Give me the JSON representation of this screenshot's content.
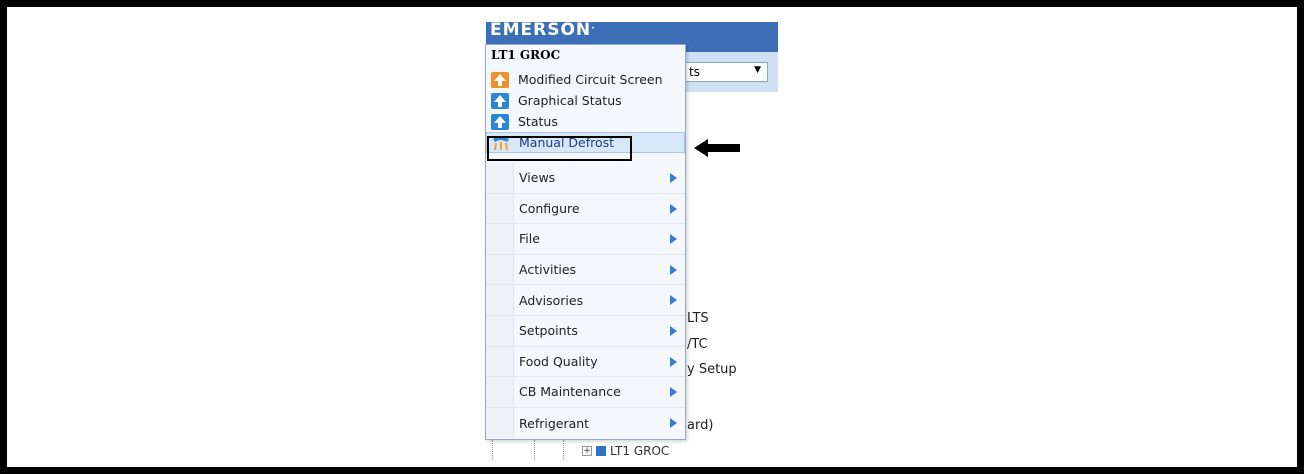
{
  "background": {
    "logo": "EMERSON",
    "select_value": "ts",
    "fragments": [
      "LTS",
      "/TC",
      "y Setup",
      "ard)"
    ],
    "tree_node_label": "LT1 GROC"
  },
  "menu": {
    "title": "LT1 GROC",
    "quick_items": [
      {
        "label": "Modified Circuit Screen",
        "icon": "circuit-icon",
        "color": "#f0902a"
      },
      {
        "label": "Graphical Status",
        "icon": "graphical-status-icon",
        "color": "#2a86d6"
      },
      {
        "label": "Status",
        "icon": "status-icon",
        "color": "#2a86d6"
      },
      {
        "label": "Manual Defrost",
        "icon": "defrost-icon",
        "color": "#f0a030"
      }
    ],
    "submenus": [
      {
        "label": "Views"
      },
      {
        "label": "Configure"
      },
      {
        "label": "File"
      },
      {
        "label": "Activities"
      },
      {
        "label": "Advisories"
      },
      {
        "label": "Setpoints"
      },
      {
        "label": "Food Quality"
      },
      {
        "label": "CB Maintenance"
      },
      {
        "label": "Refrigerant"
      }
    ]
  },
  "colors": {
    "header_blue": "#3d6fb6",
    "menu_bg": "#f4f7fb",
    "highlight": "#d7e7f7",
    "submenu_arrow": "#3b7bd6"
  }
}
